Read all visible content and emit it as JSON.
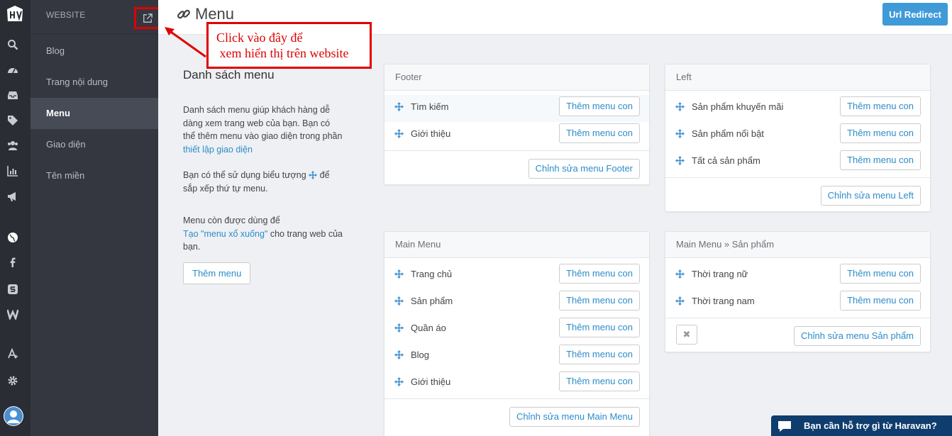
{
  "rail": {
    "icons": [
      "logo-icon",
      "search-icon",
      "dashboard-icon",
      "inbox-icon",
      "tag-icon",
      "customers-icon",
      "reports-icon",
      "megaphone-icon",
      "globe-icon",
      "facebook-icon",
      "s-channel-icon",
      "w-channel-icon",
      "apps-icon",
      "settings-icon",
      "user-avatar-icon"
    ]
  },
  "sidebar": {
    "section_label": "WEBSITE",
    "items": [
      {
        "label": "Blog"
      },
      {
        "label": "Trang nội dung"
      },
      {
        "label": "Menu",
        "active": true
      },
      {
        "label": "Giao diện"
      },
      {
        "label": "Tên miền"
      }
    ]
  },
  "topbar": {
    "title": "Menu",
    "redirect_button": "Url Redirect"
  },
  "annotation": {
    "line1": "Click vào đây để",
    "line2": " xem hiển thị trên website",
    "color": "#e00000"
  },
  "intro": {
    "heading": "Danh sách menu",
    "p1": "Danh sách menu giúp khách hàng dễ dàng xem trang web của bạn. Bạn có thể thêm menu vào giao diện trong phần ",
    "p1_link": "thiết lập giao diện",
    "p2_before": "Bạn có thể sử dụng biểu tượng ",
    "p2_after": " để sắp xếp thứ tự menu.",
    "p3_before": "Menu còn được dùng để",
    "p3_link": "Tạo \"menu xổ xuống\"",
    "p3_after": " cho trang web của bạn.",
    "add_button": "Thêm menu"
  },
  "add_child_label": "Thêm menu con",
  "menus": {
    "footer": {
      "title": "Footer",
      "items": [
        "Tìm kiếm",
        "Giới thiệu"
      ],
      "edit_button": "Chỉnh sửa menu Footer"
    },
    "left": {
      "title": "Left",
      "items": [
        "Sản phẩm khuyến mãi",
        "Sản phẩm nổi bật",
        "Tất cả sản phẩm"
      ],
      "edit_button": "Chỉnh sửa menu Left"
    },
    "main": {
      "title": "Main Menu",
      "items": [
        "Trang chủ",
        "Sản phẩm",
        "Quần áo",
        "Blog",
        "Giới thiệu"
      ],
      "edit_button": "Chỉnh sửa menu Main Menu"
    },
    "products": {
      "title": "Main Menu » Sản phẩm",
      "items": [
        "Thời trang nữ",
        "Thời trang nam"
      ],
      "edit_button": "Chỉnh sửa menu Sản phẩm"
    }
  },
  "chat": {
    "label": "Bạn cần hỗ trợ gì từ Haravan?"
  },
  "colors": {
    "accent": "#3f9ad8",
    "link": "#2d8cc9",
    "rail_bg": "#2a2d34",
    "sidebar_bg": "#34373f",
    "chat_bg": "#0f3d6e"
  }
}
